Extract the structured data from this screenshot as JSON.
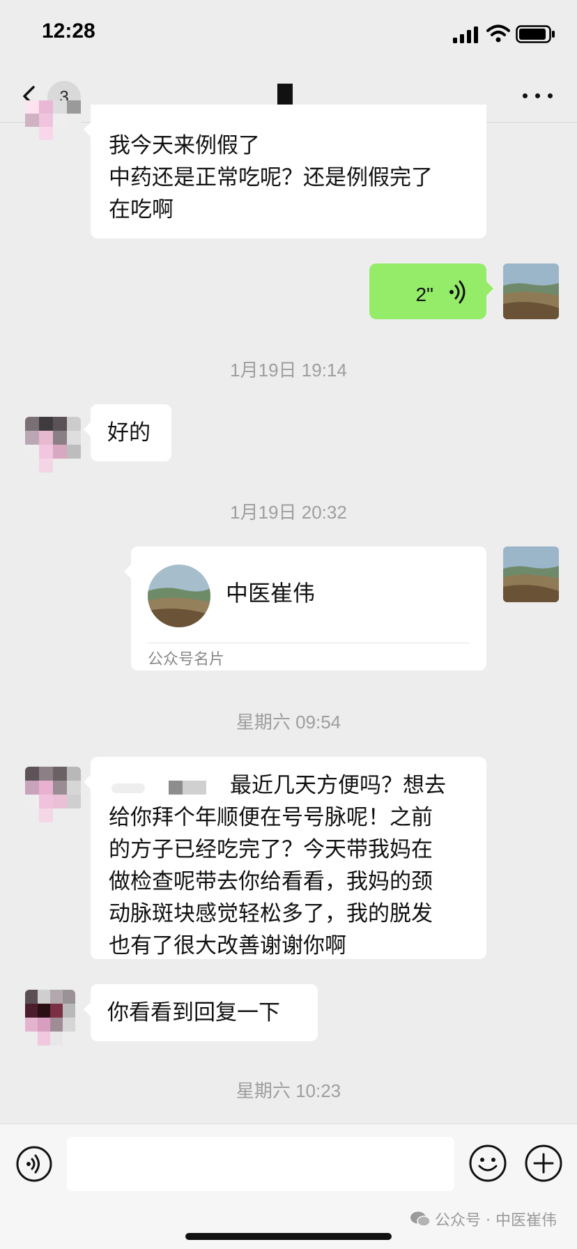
{
  "status_bar": {
    "time": "12:28"
  },
  "nav": {
    "unread_count": "3"
  },
  "messages": [
    {
      "id": "m1",
      "lines": [
        "我今天来例假了",
        "中药还是正常吃呢？还是例假完了",
        "在吃啊"
      ]
    },
    {
      "id": "m2",
      "voice_duration": "2\""
    },
    {
      "id": "t1",
      "timestamp": "1月19日 19:14"
    },
    {
      "id": "m3",
      "text": "好的"
    },
    {
      "id": "t2",
      "timestamp": "1月19日 20:32"
    },
    {
      "id": "m4",
      "card_name": "中医崔伟",
      "card_label": "公众号名片"
    },
    {
      "id": "t3",
      "timestamp": "星期六 09:54"
    },
    {
      "id": "m5",
      "lines": [
        "最近几天方便吗？想去",
        "给你拜个年顺便在号号脉呢！之前",
        "的方子已经吃完了？今天带我妈在",
        "做检查呢带去你给看看，我妈的颈",
        "动脉斑块感觉轻松多了，我的脱发",
        "也有了很大改善谢谢你啊"
      ]
    },
    {
      "id": "m6",
      "text": "你看看到回复一下"
    },
    {
      "id": "t4",
      "timestamp": "星期六 10:23"
    }
  ],
  "input": {
    "value": ""
  },
  "watermark": {
    "text": "公众号 · 中医崔伟"
  },
  "colors": {
    "background": "#ededed",
    "outgoing_bubble": "#95ec69",
    "incoming_bubble": "#ffffff",
    "timestamp": "#9e9e9e"
  },
  "icons": [
    "signal-icon",
    "wifi-icon",
    "battery-icon",
    "back-chevron-icon",
    "more-icon",
    "voice-wave-icon",
    "voice-mode-icon",
    "emoji-icon",
    "add-icon",
    "wechat-icon"
  ]
}
